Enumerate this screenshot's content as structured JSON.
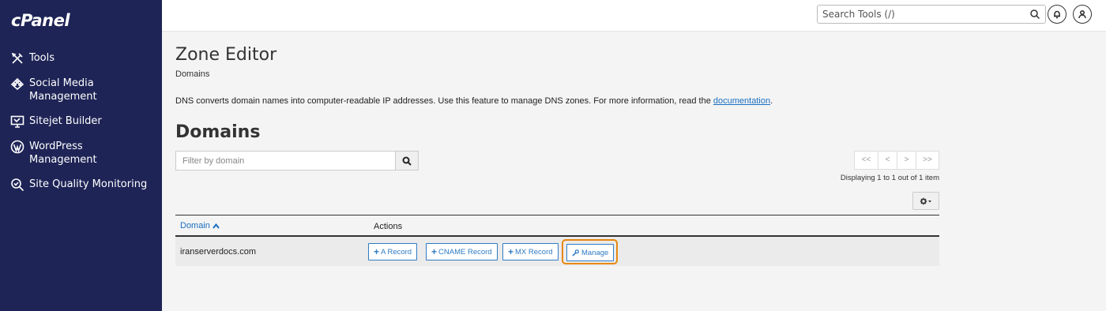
{
  "app": {
    "logo": "cPanel"
  },
  "sidebar": {
    "items": [
      {
        "label": "Tools",
        "icon": "tools-icon"
      },
      {
        "label": "Social Media Management",
        "icon": "social-media-icon"
      },
      {
        "label": "Sitejet Builder",
        "icon": "sitejet-icon"
      },
      {
        "label": "WordPress Management",
        "icon": "wordpress-icon"
      },
      {
        "label": "Site Quality Monitoring",
        "icon": "site-quality-icon"
      }
    ]
  },
  "topbar": {
    "search_placeholder": "Search Tools (/)"
  },
  "page": {
    "title": "Zone Editor",
    "breadcrumb": "Domains",
    "description": "DNS converts domain names into computer-readable IP addresses. Use this feature to manage DNS zones. For more information, read the ",
    "description_link": "documentation",
    "description_end": "."
  },
  "domains": {
    "title": "Domains",
    "filter_placeholder": "Filter by domain",
    "pager": {
      "first": "<<",
      "prev": "<",
      "next": ">",
      "last": ">>"
    },
    "displaying": "Displaying 1 to 1 out of 1 item",
    "columns": {
      "domain": "Domain",
      "actions": "Actions"
    },
    "rows": [
      {
        "domain": "iranserverdocs.com",
        "actions": {
          "a_record": "A Record",
          "cname_record": "CNAME Record",
          "mx_record": "MX Record",
          "manage": "Manage"
        }
      }
    ]
  },
  "colors": {
    "sidebar": "#1e2456",
    "link": "#1a6fc0",
    "highlight": "#e88812"
  }
}
